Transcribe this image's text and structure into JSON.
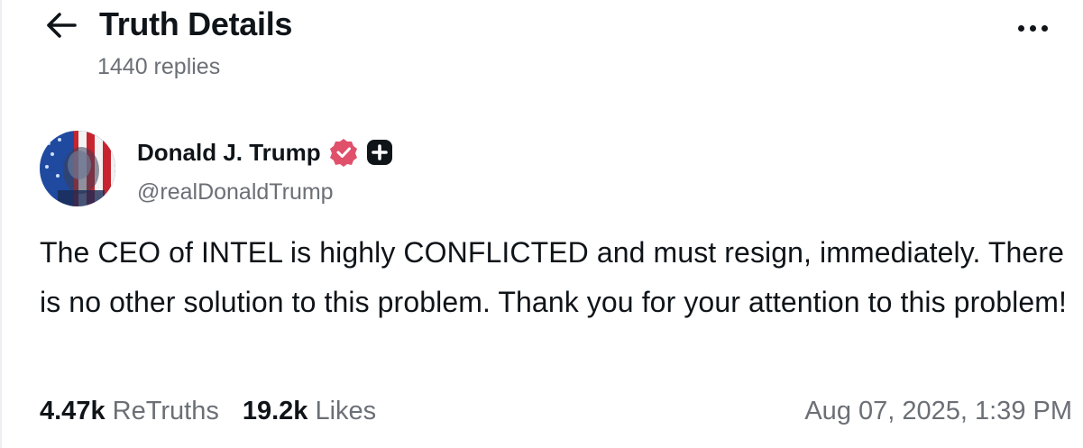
{
  "header": {
    "title": "Truth Details",
    "reply_count": "1440 replies",
    "back_icon": "arrow-left-icon",
    "more_icon": "more-horizontal-icon"
  },
  "post": {
    "author": {
      "name": "Donald J. Trump",
      "handle": "@realDonaldTrump",
      "verified_badge_color": "#e0506b",
      "plus_badge_color": "#0f1419"
    },
    "text": "The CEO of INTEL is highly CONFLICTED and must resign, immediately. There is no other solution to this problem. Thank you for your attention to this problem!",
    "stats": {
      "retruths_count": "4.47k",
      "retruths_label": "ReTruths",
      "likes_count": "19.2k",
      "likes_label": "Likes"
    },
    "timestamp": "Aug 07, 2025, 1:39 PM"
  },
  "colors": {
    "text_primary": "#0f1419",
    "text_secondary": "#6b6f76",
    "background": "#ffffff"
  }
}
